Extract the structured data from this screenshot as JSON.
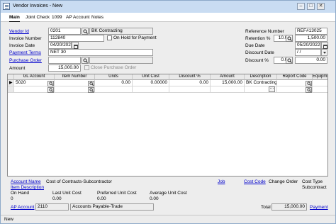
{
  "window": {
    "title": "Vendor Invoices - New"
  },
  "tabs": [
    "Main",
    "Joint Check",
    "1099",
    "AP Account",
    "Notes"
  ],
  "form": {
    "vendor_id": {
      "label": "Vendor Id",
      "value": "0201",
      "name": "BK Contracting"
    },
    "invoice_number": {
      "label": "Invoice Number",
      "value": "112840"
    },
    "on_hold": {
      "label": "On Hold for Payment"
    },
    "invoice_date": {
      "label": "Invoice Date",
      "value": "04/20/2022"
    },
    "payment_terms": {
      "label": "Payment Terms",
      "value": "NET 30"
    },
    "purchase_order": {
      "label": "Purchase Order",
      "value": ""
    },
    "close_po": {
      "label": "Close Purchase Order"
    },
    "amount": {
      "label": "Amount",
      "value": "15,000.00"
    },
    "reference_number": {
      "label": "Reference Number",
      "value": "REF#13025"
    },
    "retention": {
      "label": "Retention %",
      "pct": "10.00",
      "amount": "1,500.00"
    },
    "due_date": {
      "label": "Due Date",
      "value": "05/20/2022"
    },
    "discount_date": {
      "label": "Discount Date",
      "value": "/  /"
    },
    "discount_pct": {
      "label": "Discount %",
      "pct": "0.00",
      "amount": "0.00"
    }
  },
  "grid": {
    "headers": [
      "GL Account",
      "Item Number",
      "Units",
      "Unit Cost",
      "Discount %",
      "Amount",
      "Description",
      "Report Code",
      "Equipme"
    ],
    "rows": [
      {
        "gl": "5020",
        "item": "",
        "units": "0.00",
        "unit_cost": "0.00000",
        "discount": "0.00",
        "amount": "15,000.00",
        "description": "BK Contracting",
        "report_code": "",
        "equip": ""
      }
    ]
  },
  "details": {
    "account_name_label": "Account Name",
    "account_name_value": "Cost of Contracts-Subcontractor",
    "item_description_label": "Item Description",
    "job_label": "Job",
    "cost_code_label": "Cost Code",
    "change_order_label": "Change Order",
    "cost_type_label": "Cost Type",
    "cost_type_value": "Subcontract",
    "on_hand_label": "On Hand",
    "on_hand_value": "0",
    "last_unit_cost_label": "Last Unit Cost",
    "last_unit_cost_value": "0.00",
    "preferred_unit_cost_label": "Preferred Unit Cost",
    "preferred_unit_cost_value": "0.00",
    "average_unit_cost_label": "Average Unit Cost",
    "average_unit_cost_value": "0.00"
  },
  "footer": {
    "ap_account_label": "AP Account",
    "ap_account_value": "2110",
    "ap_account_name": "Accounts Payable-Trade",
    "total_label": "Total",
    "total_value": "15,000.00",
    "payment_link": "Payment"
  },
  "status": {
    "text": "New"
  }
}
